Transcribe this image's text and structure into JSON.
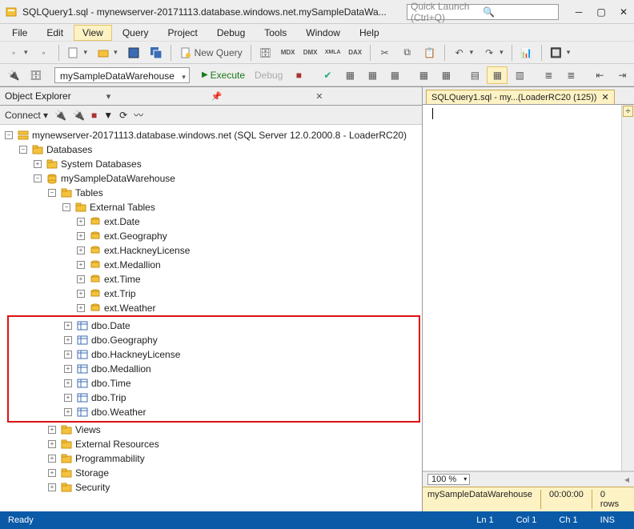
{
  "window": {
    "title": "SQLQuery1.sql - mynewserver-20171113.database.windows.net.mySampleDataWa...",
    "quicklaunch_placeholder": "Quick Launch (Ctrl+Q)"
  },
  "menubar": [
    "File",
    "Edit",
    "View",
    "Query",
    "Project",
    "Debug",
    "Tools",
    "Window",
    "Help"
  ],
  "menubar_highlight_index": 2,
  "toolbar1": {
    "new_query": "New Query"
  },
  "toolbar2": {
    "db_combo": "mySampleDataWarehouse",
    "execute": "Execute",
    "debug": "Debug"
  },
  "explorer": {
    "title": "Object Explorer",
    "connect": "Connect",
    "server": "mynewserver-20171113.database.windows.net (SQL Server 12.0.2000.8 - LoaderRC20)",
    "databases": "Databases",
    "system_databases": "System Databases",
    "my_dw": "mySampleDataWarehouse",
    "tables": "Tables",
    "external_tables": "External Tables",
    "ext": [
      "ext.Date",
      "ext.Geography",
      "ext.HackneyLicense",
      "ext.Medallion",
      "ext.Time",
      "ext.Trip",
      "ext.Weather"
    ],
    "dbo": [
      "dbo.Date",
      "dbo.Geography",
      "dbo.HackneyLicense",
      "dbo.Medallion",
      "dbo.Time",
      "dbo.Trip",
      "dbo.Weather"
    ],
    "folders": [
      "Views",
      "External Resources",
      "Programmability",
      "Storage",
      "Security"
    ]
  },
  "editor": {
    "tab": "SQLQuery1.sql - my...(LoaderRC20 (125))",
    "zoom": "100 %",
    "result_db": "mySampleDataWarehouse",
    "result_time": "00:00:00",
    "result_rows": "0 rows"
  },
  "status": {
    "ready": "Ready",
    "ln": "Ln 1",
    "col": "Col 1",
    "ch": "Ch 1",
    "ins": "INS"
  }
}
